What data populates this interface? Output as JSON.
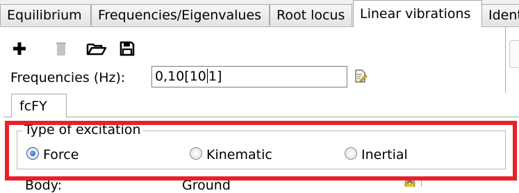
{
  "tabs": [
    {
      "label": "Equilibrium",
      "active": false
    },
    {
      "label": "Frequencies/Eigenvalues",
      "active": false
    },
    {
      "label": "Root locus",
      "active": false
    },
    {
      "label": "Linear vibrations",
      "active": true
    },
    {
      "label": "Identi",
      "active": false
    }
  ],
  "toolbar": {
    "add_icon": "plus-icon",
    "delete_icon": "trash-icon",
    "open_icon": "folder-open-icon",
    "save_icon": "floppy-disk-icon"
  },
  "frequencies": {
    "label": "Frequencies (Hz):",
    "value_before_caret": "0,10[10",
    "value_after_caret": "1]",
    "edit_icon": "edit-note-icon"
  },
  "subtab": {
    "label": "fcFY"
  },
  "excitation": {
    "legend": "Type of excitation",
    "options": [
      {
        "label": "Force",
        "checked": true
      },
      {
        "label": "Kinematic",
        "checked": false
      },
      {
        "label": "Inertial",
        "checked": false
      }
    ]
  },
  "body_row": {
    "label": "Body:",
    "value": "Ground"
  },
  "colors": {
    "highlight": "#e8202a",
    "tab_border": "#a9a9a9",
    "radio_selected": "#1a4fc0"
  }
}
